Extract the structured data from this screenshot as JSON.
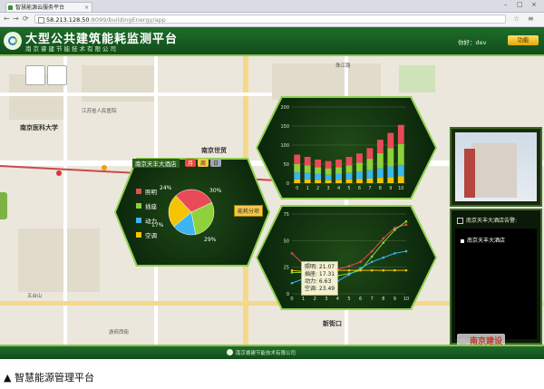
{
  "browser": {
    "tab_title": "智慧能源云服务平台",
    "url_host": "58.213.128.50",
    "url_path": ":8099/buildingEnergy/app"
  },
  "app": {
    "title": "大型公共建筑能耗监测平台",
    "subtitle": "南京睿建节能技术有限公司",
    "user_label": "你好：dev",
    "func_button": "功能"
  },
  "map_labels": [
    {
      "text": "南京医科大学",
      "cls": "big"
    },
    {
      "text": "南京世贸"
    },
    {
      "text": "新街口"
    },
    {
      "text": "游府西街"
    },
    {
      "text": "珠江路"
    },
    {
      "text": "江苏省人民医院"
    },
    {
      "text": "五台山"
    }
  ],
  "pie_panel": {
    "building": "南京天丰大酒店",
    "tabs": [
      "月",
      "周",
      "日"
    ],
    "category_button": "能耗分项",
    "legend": [
      {
        "label": "照明",
        "color": "#e84b57"
      },
      {
        "label": "插座",
        "color": "#8ed13a"
      },
      {
        "label": "动力",
        "color": "#3bb6f0"
      },
      {
        "label": "空调",
        "color": "#f5c400"
      }
    ],
    "percent_labels": [
      "30%",
      "29%",
      "17%",
      "24%"
    ]
  },
  "chart_data": [
    {
      "type": "bar",
      "stacked": true,
      "categories": [
        "0",
        "1",
        "2",
        "3",
        "4",
        "5",
        "6",
        "7",
        "8",
        "9",
        "10"
      ],
      "ylim": [
        0,
        200
      ],
      "yticks": [
        0,
        50,
        100,
        150,
        200
      ],
      "series": [
        {
          "color": "#f5c400",
          "values": [
            10,
            10,
            9,
            8,
            9,
            10,
            11,
            12,
            14,
            16,
            18
          ]
        },
        {
          "color": "#3bb6f0",
          "values": [
            18,
            17,
            15,
            14,
            15,
            17,
            19,
            22,
            25,
            28,
            30
          ]
        },
        {
          "color": "#8ed13a",
          "values": [
            22,
            20,
            18,
            17,
            18,
            20,
            24,
            30,
            40,
            48,
            55
          ]
        },
        {
          "color": "#e84b57",
          "values": [
            25,
            22,
            20,
            19,
            20,
            22,
            24,
            28,
            35,
            40,
            50
          ]
        }
      ]
    },
    {
      "type": "line",
      "x": [
        "0",
        "1",
        "2",
        "3",
        "4",
        "5",
        "6",
        "7",
        "8",
        "9",
        "10"
      ],
      "ylim": [
        0,
        75
      ],
      "yticks": [
        0,
        25,
        50,
        75
      ],
      "series": [
        {
          "color": "#e84b57",
          "values": [
            38,
            28,
            22,
            20,
            23,
            26,
            30,
            40,
            52,
            62,
            65
          ]
        },
        {
          "color": "#8ed13a",
          "values": [
            20,
            20,
            18,
            17,
            17,
            19,
            22,
            35,
            48,
            60,
            68
          ]
        },
        {
          "color": "#3bb6f0",
          "values": [
            10,
            14,
            8,
            6,
            12,
            18,
            24,
            30,
            34,
            38,
            40
          ]
        },
        {
          "color": "#f5c400",
          "values": [
            22,
            21,
            21,
            21,
            22,
            22,
            22,
            22,
            22,
            22,
            22
          ]
        }
      ],
      "tooltip": [
        "照明: 21.07",
        "插座: 17.31",
        "动力: 6.63",
        "空调: 23.49"
      ]
    }
  ],
  "side": {
    "panel_head": "南京天丰大酒店告警:",
    "item": "南京天丰大酒店"
  },
  "watermark": "南京建设",
  "footer": "南京睿建节能技术有限公司",
  "caption": "▲ 智慧能源管理平台"
}
